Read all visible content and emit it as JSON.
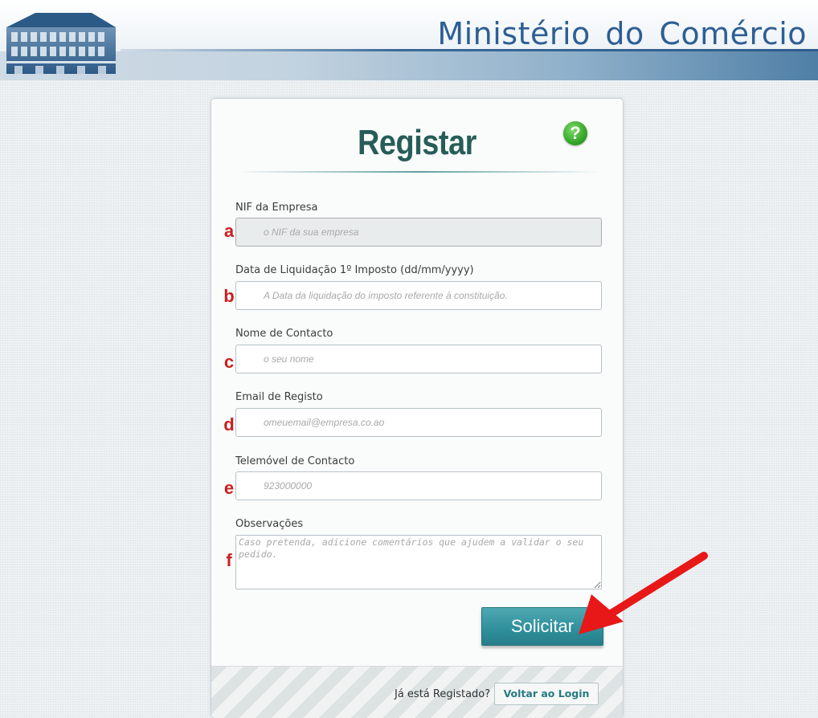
{
  "header": {
    "site_title": "Ministério do Comércio",
    "logo_icon": "ministry-building-logo"
  },
  "form": {
    "title": "Registar",
    "help_icon": "question-mark-icon",
    "help_glyph": "?",
    "fields": [
      {
        "letter": "a",
        "label": "NIF da Empresa",
        "placeholder": "o NIF da sua empresa",
        "value": "",
        "disabled": true
      },
      {
        "letter": "b",
        "label": "Data de Liquidação 1º Imposto (dd/mm/yyyy)",
        "placeholder": "A Data da liquidação do imposto referente à constituição.",
        "value": ""
      },
      {
        "letter": "c",
        "label": "Nome de Contacto",
        "placeholder": "o seu nome",
        "value": ""
      },
      {
        "letter": "d",
        "label": "Email de Registo",
        "placeholder": "omeuemail@empresa.co.ao",
        "value": ""
      },
      {
        "letter": "e",
        "label": "Telemóvel de Contacto",
        "placeholder": "923000000",
        "value": ""
      }
    ],
    "notes": {
      "letter": "f",
      "label": "Observações",
      "placeholder": "Caso pretenda, adicione comentários que ajudem a validar o seu pedido.",
      "value": ""
    },
    "submit_label": "Solicitar"
  },
  "footer": {
    "text": "Já está Registado?",
    "login_label": "Voltar ao Login"
  },
  "annotation": {
    "arrow_icon": "red-arrow-icon",
    "arrow_color": "#e81818"
  },
  "colors": {
    "accent": "#2e8f9b",
    "title": "#275d57",
    "header_text": "#2e5e94",
    "letter": "#cc1f1f"
  }
}
